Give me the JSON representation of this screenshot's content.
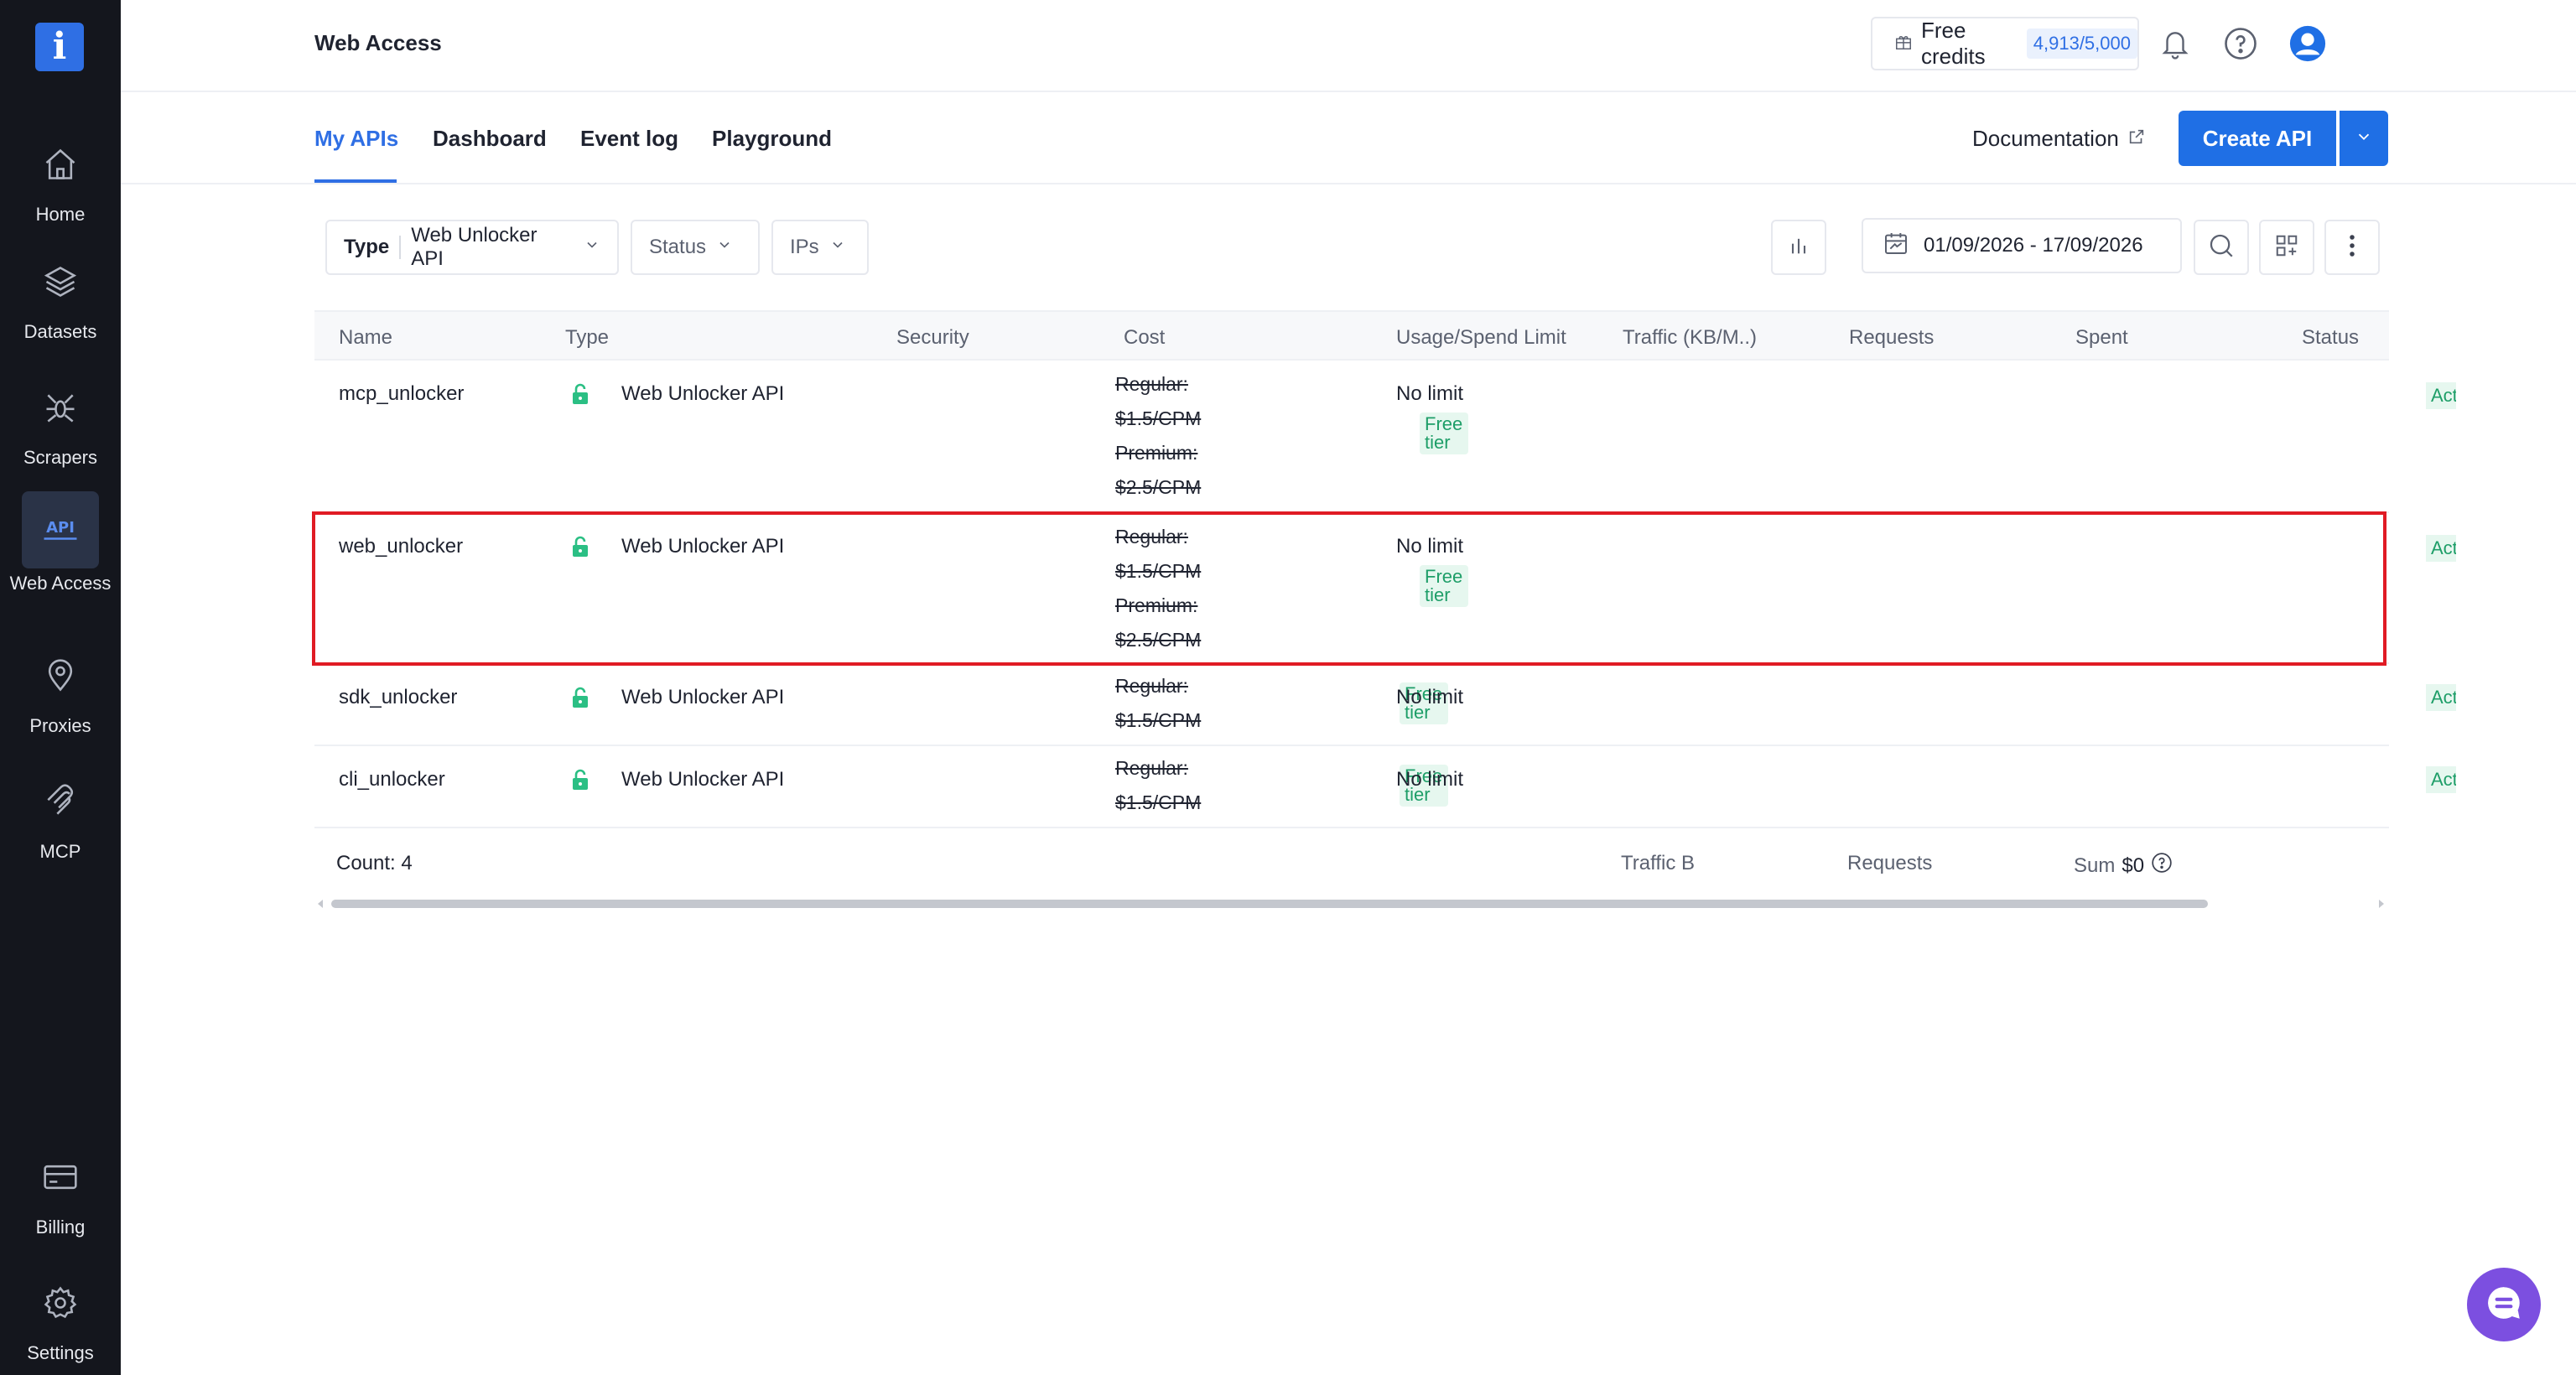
{
  "sidebar": {
    "logo": "i",
    "items": [
      {
        "label": "Home",
        "icon": "home-icon"
      },
      {
        "label": "Datasets",
        "icon": "layers-icon"
      },
      {
        "label": "Scrapers",
        "icon": "spider-icon"
      },
      {
        "label": "Web Access",
        "icon": "api-icon",
        "active": true
      },
      {
        "label": "Proxies",
        "icon": "location-pin-icon"
      },
      {
        "label": "MCP",
        "icon": "mcp-icon"
      },
      {
        "label": "Billing",
        "icon": "card-icon"
      },
      {
        "label": "Settings",
        "icon": "gear-icon"
      }
    ]
  },
  "header": {
    "title": "Web Access",
    "credits_label": "Free credits",
    "credits_value": "4,913/5,000"
  },
  "tabs": [
    {
      "label": "My APIs",
      "active": true
    },
    {
      "label": "Dashboard"
    },
    {
      "label": "Event log"
    },
    {
      "label": "Playground"
    }
  ],
  "actions": {
    "documentation": "Documentation",
    "create_api": "Create API"
  },
  "filters": {
    "type_label": "Type",
    "type_value": "Web Unlocker API",
    "status": "Status",
    "ips": "IPs",
    "date_range": "01/09/2026 - 17/09/2026"
  },
  "table": {
    "columns": [
      "Name",
      "Type",
      "Security",
      "Cost",
      "Usage/Spend Limit",
      "Traffic (KB/M..)",
      "Requests",
      "Spent",
      "Status"
    ],
    "rows": [
      {
        "name": "mcp_unlocker",
        "type": "Web Unlocker API",
        "cost": [
          "Regular:",
          "$1.5/CPM",
          "Premium:",
          "$2.5/CPM"
        ],
        "free": "Free tier",
        "limit": "No limit",
        "status": "Act"
      },
      {
        "name": "web_unlocker",
        "type": "Web Unlocker API",
        "cost": [
          "Regular:",
          "$1.5/CPM",
          "Premium:",
          "$2.5/CPM"
        ],
        "free": "Free tier",
        "limit": "No limit",
        "status": "Act"
      },
      {
        "name": "sdk_unlocker",
        "type": "Web Unlocker API",
        "cost": [
          "Regular:",
          "$1.5/CPM"
        ],
        "free": "Free tier",
        "limit": "No limit",
        "status": "Act"
      },
      {
        "name": "cli_unlocker",
        "type": "Web Unlocker API",
        "cost": [
          "Regular:",
          "$1.5/CPM"
        ],
        "free": "Free tier",
        "limit": "No limit",
        "status": "Act"
      }
    ],
    "footer": {
      "count": "Count: 4",
      "traffic": "Traffic B",
      "requests": "Requests",
      "sum": "Sum",
      "sum_value": "$0"
    }
  },
  "colors": {
    "accent": "#1f6fe5",
    "sidebar_bg": "#14161d",
    "highlight": "#e01b24",
    "tag_green": "#1e9e68"
  }
}
